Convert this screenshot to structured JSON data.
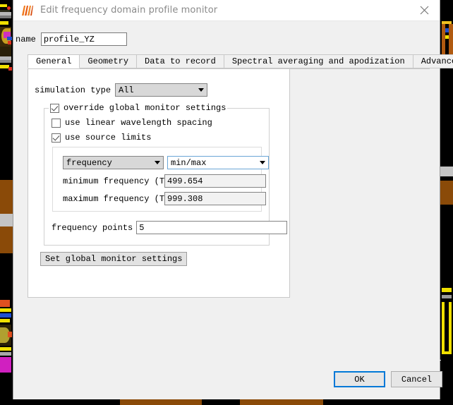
{
  "window": {
    "title": "Edit frequency domain profile monitor",
    "app_icon": "lumerical-logo-icon",
    "close_icon": "close-icon"
  },
  "name_field": {
    "label": "name",
    "value": "profile_YZ",
    "placeholder": ""
  },
  "tabs": [
    {
      "label": "General",
      "active": true
    },
    {
      "label": "Geometry",
      "active": false
    },
    {
      "label": "Data to record",
      "active": false
    },
    {
      "label": "Spectral averaging and apodization",
      "active": false
    },
    {
      "label": "Advanced",
      "active": false
    }
  ],
  "general": {
    "simulation_type": {
      "label": "simulation type",
      "value": "All",
      "options": [
        "All"
      ]
    },
    "override_group": {
      "checkbox_label": "override global monitor settings",
      "checked": true
    },
    "use_linear_wavelength_spacing": {
      "label": "use linear wavelength spacing",
      "checked": false
    },
    "use_source_limits": {
      "label": "use source limits",
      "checked": true
    },
    "frequency_group": {
      "domain_combo": {
        "value": "frequency",
        "options": [
          "frequency"
        ]
      },
      "range_combo": {
        "value": "min/max",
        "options": [
          "min/max"
        ]
      },
      "minimum": {
        "label": "minimum frequency (THz)",
        "value": "499.654"
      },
      "maximum": {
        "label": "maximum frequency (THz)",
        "value": "999.308"
      }
    },
    "frequency_points": {
      "label": "frequency points",
      "value": "5"
    },
    "set_global_button": "Set global monitor settings"
  },
  "footer": {
    "ok_label": "OK",
    "cancel_label": "Cancel"
  },
  "colors": {
    "accent_focus": "#0078d7",
    "combo_focus_border": "#6aa6d6",
    "dialog_bg": "#f0f0f0",
    "panel_bg": "#ffffff",
    "title_text": "#8a8a8a"
  }
}
